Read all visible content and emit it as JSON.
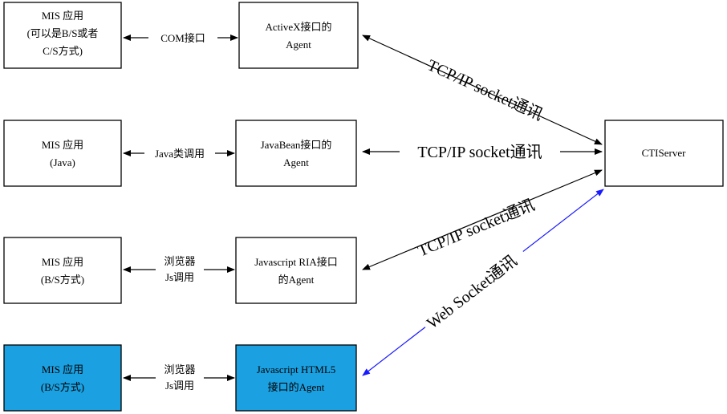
{
  "mis_boxes": [
    {
      "lines": [
        "MIS 应用",
        "(可以是B/S或者",
        "C/S方式)"
      ]
    },
    {
      "lines": [
        "MIS 应用",
        "(Java)"
      ]
    },
    {
      "lines": [
        "MIS 应用",
        "(B/S方式)"
      ]
    },
    {
      "lines": [
        "MIS 应用",
        "(B/S方式)"
      ],
      "highlight": true
    }
  ],
  "agent_boxes": [
    {
      "lines": [
        "ActiveX接口的",
        "Agent"
      ]
    },
    {
      "lines": [
        "JavaBean接口的",
        "Agent"
      ]
    },
    {
      "lines": [
        "Javascript RIA接口",
        "的Agent"
      ]
    },
    {
      "lines": [
        "Javascript HTML5",
        "接口的Agent"
      ],
      "highlight": true
    }
  ],
  "link_labels": [
    {
      "lines": [
        "COM接口"
      ]
    },
    {
      "lines": [
        "Java类调用"
      ]
    },
    {
      "lines": [
        "浏览器",
        "Js调用"
      ]
    },
    {
      "lines": [
        "浏览器",
        "Js调用"
      ]
    }
  ],
  "server": {
    "label": "CTIServer"
  },
  "connections": [
    {
      "label": "TCP/IP socket通讯"
    },
    {
      "label": "TCP/IP socket通讯"
    },
    {
      "label": "TCP/IP socket通讯"
    },
    {
      "label": "Web Socket通讯"
    }
  ],
  "colors": {
    "highlight_fill": "#1ba1e2",
    "websocket_line": "#1a1aff",
    "line": "#000000"
  }
}
